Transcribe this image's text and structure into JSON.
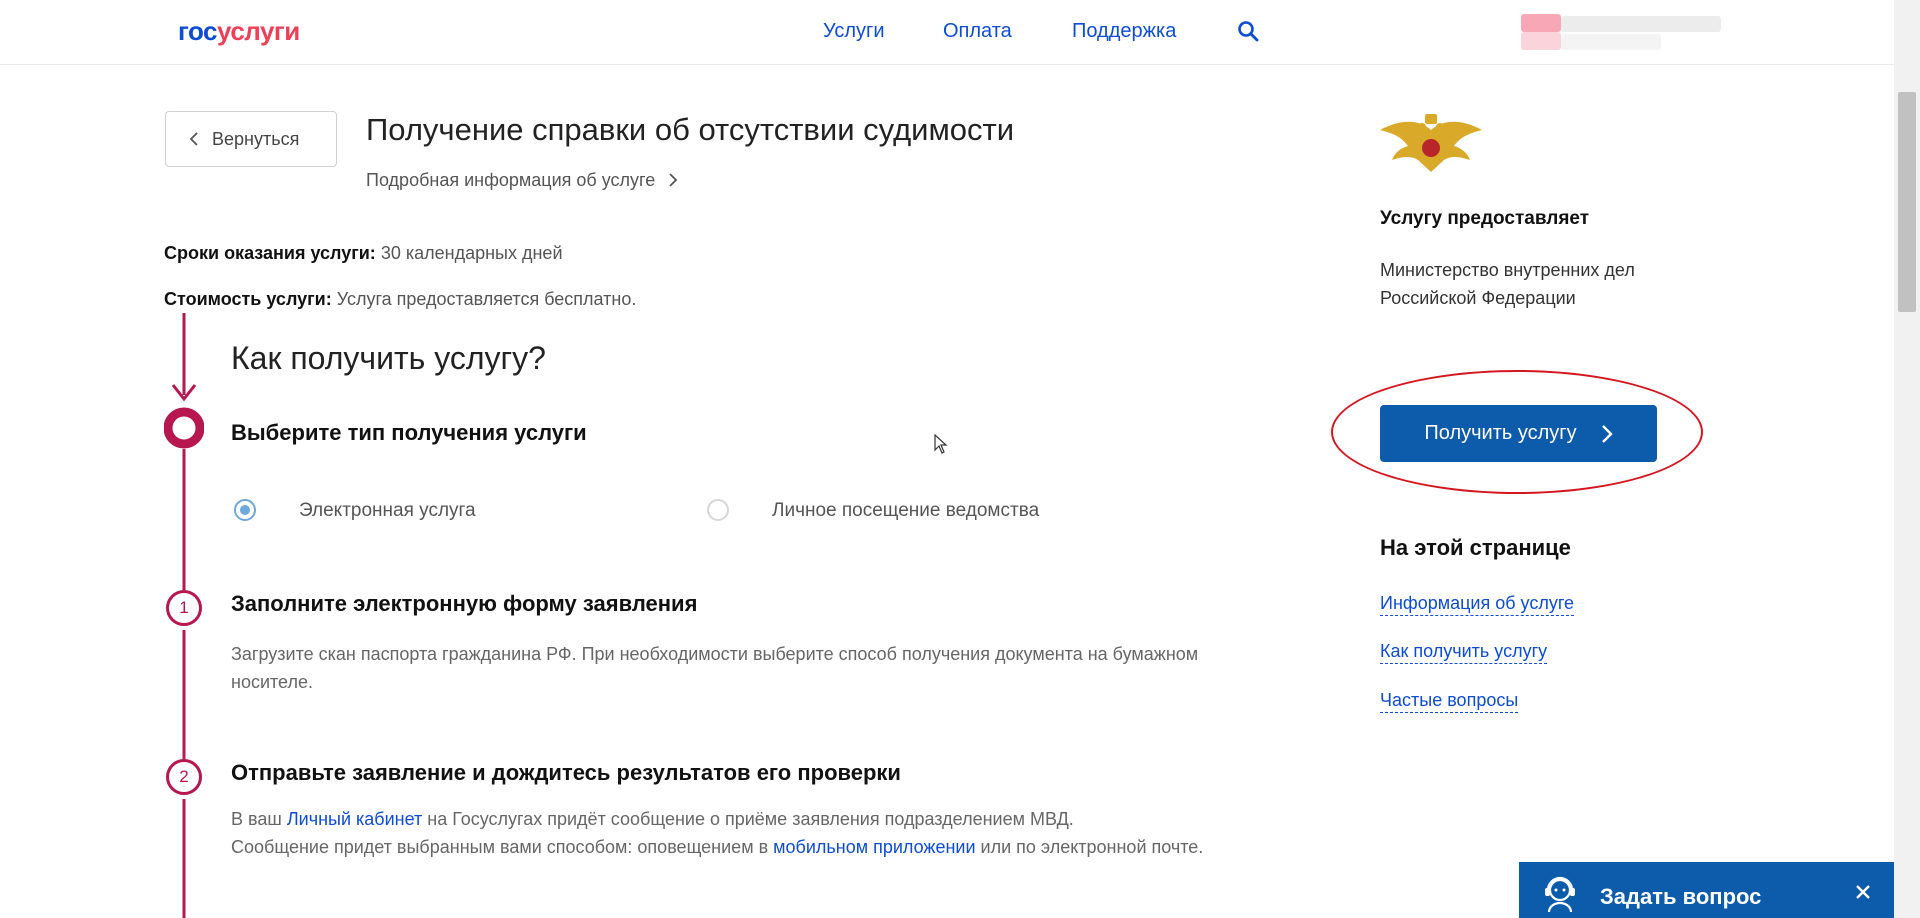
{
  "header": {
    "logo_part1": "гос",
    "logo_part2": "услуги",
    "nav": [
      "Услуги",
      "Оплата",
      "Поддержка"
    ]
  },
  "main": {
    "back_label": "Вернуться",
    "title": "Получение справки об отсутствии судимости",
    "detail_link": "Подробная информация об услуге",
    "term_label": "Сроки оказания услуги:",
    "term_value": "30 календарных дней",
    "cost_label": "Стоимость услуги:",
    "cost_value": "Услуга предоставляется бесплатно.",
    "how_title": "Как получить услугу?",
    "step0_title": "Выберите тип получения услуги",
    "radio_option1": "Электронная услуга",
    "radio_option2": "Личное посещение ведомства",
    "step1_number": "1",
    "step1_title": "Заполните электронную форму заявления",
    "step1_text": "Загрузите скан паспорта гражданина РФ. При необходимости выберите способ получения документа на бумажном носителе.",
    "step2_number": "2",
    "step2_title": "Отправьте заявление и дождитесь результатов его проверки",
    "step2_text_a": "В ваш ",
    "step2_link1": "Личный кабинет",
    "step2_text_b": " на Госуслугах придёт сообщение о приёме заявления подразделением МВД.",
    "step2_text_c": "Сообщение придет выбранным вами способом: оповещением в ",
    "step2_link2": "мобильном приложении",
    "step2_text_d": " или по электронной почте."
  },
  "sidebar": {
    "provider_heading": "Услугу предоставляет",
    "provider_name": "Министерство внутренних дел Российской Федерации",
    "get_button": "Получить услугу",
    "on_page_heading": "На этой странице",
    "on_page_links": [
      "Информация об услуге",
      "Как получить услугу",
      "Частые вопросы"
    ]
  },
  "ask_widget": {
    "label": "Задать вопрос"
  },
  "colors": {
    "brand_blue": "#0d4cd3",
    "button_blue": "#0d5bab",
    "brand_red": "#ee3f58",
    "timeline": "#b5174e",
    "annotation_red": "#d5161f"
  },
  "icons": [
    "search-icon",
    "chevron-left-icon",
    "chevron-right-icon",
    "emblem-icon",
    "support-agent-icon",
    "close-icon",
    "mouse-cursor-icon"
  ]
}
